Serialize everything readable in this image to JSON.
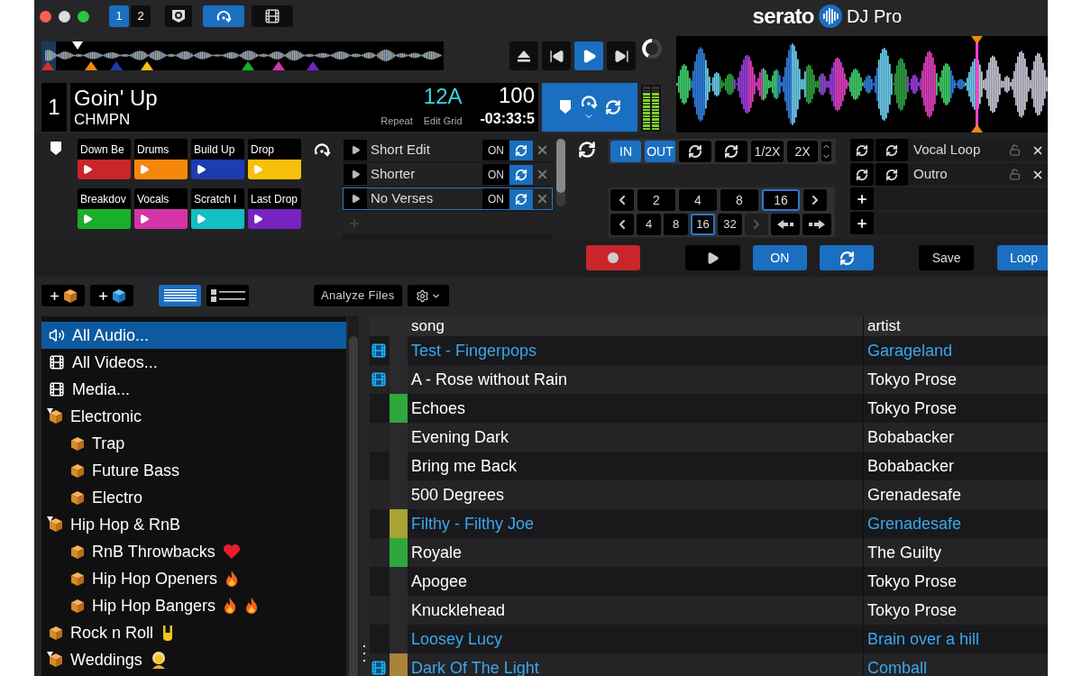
{
  "top_bar": {
    "decks": [
      {
        "label": "1",
        "selected": true
      },
      {
        "label": "2",
        "selected": false
      }
    ],
    "panels": [
      {
        "kind": "cues",
        "selected": false
      },
      {
        "kind": "loops",
        "selected": true
      },
      {
        "kind": "video",
        "selected": false
      }
    ],
    "logo": {
      "brand": "serato",
      "product": "DJ Pro"
    }
  },
  "deck": {
    "number": "1",
    "title": "Goin' Up",
    "artist": "CHMPN",
    "key": "12A",
    "bpm": "100",
    "repeat_label": "Repeat",
    "edit_grid_label": "Edit Grid",
    "time": "-03:33:5",
    "playing": true,
    "meter": {
      "level": 0.85
    }
  },
  "cue_pads": [
    {
      "label": "Down Be",
      "color": "#c8262a"
    },
    {
      "label": "Drums",
      "color": "#f5880c"
    },
    {
      "label": "Build Up",
      "color": "#1c3cb0"
    },
    {
      "label": "Drop",
      "color": "#f8c00a"
    },
    {
      "label": "Breakdov",
      "color": "#1aaf2a"
    },
    {
      "label": "Vocals",
      "color": "#d534a6"
    },
    {
      "label": "Scratch I",
      "color": "#13bec4"
    },
    {
      "label": "Last Drop",
      "color": "#7722c2"
    }
  ],
  "loops": [
    {
      "name": "Short Edit",
      "toggle": "ON",
      "selected": false
    },
    {
      "name": "Shorter",
      "toggle": "ON",
      "selected": false
    },
    {
      "name": "No Verses",
      "toggle": "ON",
      "selected": true
    }
  ],
  "loop_controls": {
    "in": {
      "label": "IN",
      "on": true
    },
    "out": {
      "label": "OUT",
      "on": true
    },
    "half": "1/2X",
    "double": "2X",
    "loop_sizes": [
      {
        "label": "2",
        "selected": false
      },
      {
        "label": "4",
        "selected": false
      },
      {
        "label": "8",
        "selected": false
      },
      {
        "label": "16",
        "selected": true
      }
    ],
    "jump_sizes": [
      {
        "label": "4",
        "selected": false
      },
      {
        "label": "8",
        "selected": false
      },
      {
        "label": "16",
        "selected": true
      },
      {
        "label": "32",
        "selected": false
      }
    ]
  },
  "saved_loops": [
    {
      "kind": "loop",
      "name": "Vocal Loop"
    },
    {
      "kind": "loop",
      "name": "Outro"
    },
    {
      "kind": "empty"
    },
    {
      "kind": "empty"
    }
  ],
  "action_buttons": [
    {
      "kind": "record"
    },
    {
      "kind": "play"
    },
    {
      "kind": "text",
      "label": "ON",
      "highlighted": true
    },
    {
      "kind": "loop"
    },
    {
      "kind": "text",
      "label": "Save",
      "highlighted": false
    },
    {
      "kind": "text",
      "label": "Loop",
      "highlighted": true
    }
  ],
  "library_toolbar": {
    "add_buttons": [
      {
        "kind": "crate"
      },
      {
        "kind": "smart-crate"
      }
    ],
    "views": [
      {
        "kind": "simple",
        "selected": true
      },
      {
        "kind": "detailed",
        "selected": false
      }
    ],
    "analyze": "Analyze Files"
  },
  "sidebar": {
    "items": [
      {
        "kind": "audio",
        "label": "All Audio...",
        "selected": true,
        "expanded": false
      },
      {
        "kind": "video",
        "label": "All Videos...",
        "selected": false,
        "expanded": false
      },
      {
        "kind": "media",
        "label": "Media...",
        "selected": false,
        "expanded": false
      },
      {
        "kind": "crate",
        "label": "Electronic",
        "selected": false,
        "expanded": true,
        "children": [
          {
            "kind": "crate",
            "label": "Trap",
            "selected": false
          },
          {
            "kind": "crate",
            "label": "Future Bass",
            "selected": false
          },
          {
            "kind": "crate",
            "label": "Electro",
            "selected": false
          }
        ]
      },
      {
        "kind": "crate",
        "label": "Hip Hop & RnB",
        "selected": false,
        "expanded": true,
        "children": [
          {
            "kind": "crate",
            "label": "RnB Throwbacks",
            "emoji": [
              {
                "kind": "heart"
              }
            ],
            "selected": false
          },
          {
            "kind": "crate",
            "label": "Hip Hop Openers",
            "emoji": [
              {
                "kind": "flame"
              }
            ],
            "selected": false
          },
          {
            "kind": "crate",
            "label": "Hip Hop Bangers",
            "emoji": [
              {
                "kind": "flame"
              },
              {
                "kind": "flame"
              }
            ],
            "selected": false
          }
        ]
      },
      {
        "kind": "crate",
        "label": "Rock n Roll",
        "emoji": [
          {
            "kind": "hand"
          }
        ],
        "selected": false,
        "expanded": false
      },
      {
        "kind": "crate",
        "label": "Weddings",
        "emoji": [
          {
            "kind": "person"
          }
        ],
        "selected": false,
        "expanded": true
      }
    ]
  },
  "library": {
    "columns": [
      "song",
      "artist"
    ],
    "rows": [
      {
        "song": "Test - Fingerpops",
        "artist": "Garageland",
        "video": true,
        "highlighted": true
      },
      {
        "song": "A - Rose without Rain",
        "artist": "Tokyo Prose",
        "video": true,
        "highlighted": false
      },
      {
        "song": "Echoes",
        "artist": "Tokyo Prose",
        "video": false,
        "highlighted": false,
        "color": "#2ea83a"
      },
      {
        "song": "Evening Dark",
        "artist": "Bobabacker",
        "video": false,
        "highlighted": false
      },
      {
        "song": "Bring me Back",
        "artist": "Bobabacker",
        "video": false,
        "highlighted": false
      },
      {
        "song": "500 Degrees",
        "artist": "Grenadesafe",
        "video": false,
        "highlighted": false
      },
      {
        "song": "Filthy - Filthy Joe",
        "artist": "Grenadesafe",
        "video": false,
        "highlighted": true,
        "color": "#aaa232"
      },
      {
        "song": "Royale",
        "artist": "The Guilty",
        "video": false,
        "highlighted": false,
        "color": "#2ea83a"
      },
      {
        "song": "Apogee",
        "artist": "Tokyo Prose",
        "video": false,
        "highlighted": false
      },
      {
        "song": "Knucklehead",
        "artist": "Tokyo Prose",
        "video": false,
        "highlighted": false
      },
      {
        "song": "Loosey Lucy",
        "artist": "Brain over a hill",
        "video": false,
        "highlighted": true
      },
      {
        "song": "Dark Of The Light",
        "artist": "Comball",
        "video": true,
        "highlighted": true,
        "color": "#a8843a"
      }
    ]
  }
}
